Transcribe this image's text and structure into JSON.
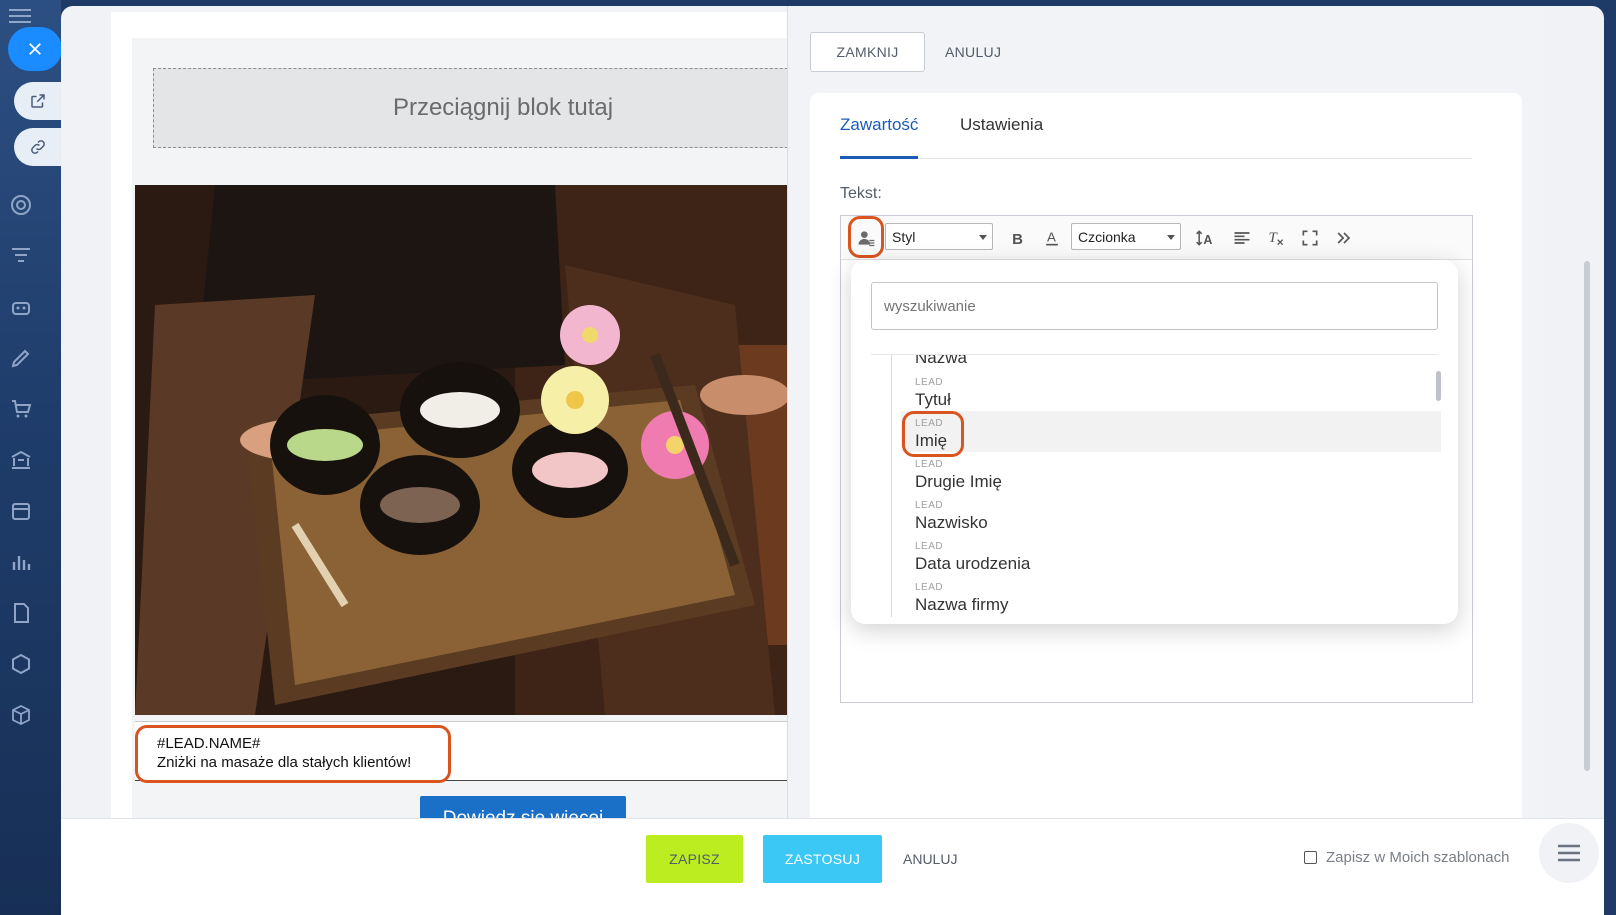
{
  "canvas": {
    "dropzone_text": "Przeciągnij blok tutaj",
    "text_line1": "#LEAD.NAME#",
    "text_line2": "Zniżki na masaże dla stałych klientów!",
    "cta_label": "Dowiedz się więcej"
  },
  "panel": {
    "close_label": "ZAMKNIJ",
    "cancel_label": "ANULUJ",
    "tabs": [
      {
        "label": "Zawartość",
        "active": true
      },
      {
        "label": "Ustawienia",
        "active": false
      }
    ],
    "text_label": "Tekst:",
    "toolbar": {
      "style_select": "Styl",
      "font_select": "Czcionka"
    },
    "popup": {
      "search_placeholder": "wyszukiwanie",
      "items": [
        {
          "tag": "",
          "name": "Nazwa"
        },
        {
          "tag": "LEAD",
          "name": "Tytuł"
        },
        {
          "tag": "LEAD",
          "name": "Imię"
        },
        {
          "tag": "LEAD",
          "name": "Drugie Imię"
        },
        {
          "tag": "LEAD",
          "name": "Nazwisko"
        },
        {
          "tag": "LEAD",
          "name": "Data urodzenia"
        },
        {
          "tag": "LEAD",
          "name": "Nazwa firmy"
        }
      ]
    }
  },
  "bottom": {
    "save_label": "ZAPISZ",
    "apply_label": "ZASTOSUJ",
    "cancel_label": "ANULUJ",
    "save_template_label": "Zapisz w Moich szablonach"
  },
  "colors": {
    "accent": "#1a5cb8",
    "highlight": "#d9541e",
    "save_green": "#bbed21",
    "apply_blue": "#3bc8f5",
    "cta_blue": "#1a6fc6"
  },
  "icons": [
    "close-icon",
    "external-link-icon",
    "link-icon",
    "target-icon",
    "filter-icon",
    "robot-icon",
    "pen-icon",
    "cart-icon",
    "bank-icon",
    "calendar-icon",
    "chart-icon",
    "document-icon",
    "hexagon-icon",
    "box-icon",
    "user-field-icon",
    "bold-icon",
    "font-color-icon",
    "text-size-icon",
    "align-icon",
    "clear-format-icon",
    "fullscreen-icon",
    "more-icon",
    "list-icon"
  ]
}
